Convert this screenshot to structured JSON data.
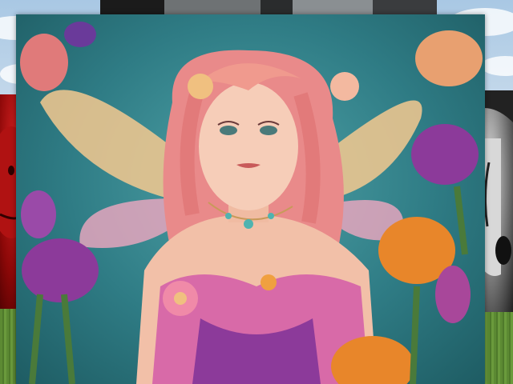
{
  "scene": {
    "description_label": "",
    "colors": {
      "teal_background": "#2f7c85",
      "hair": "#e98a8a",
      "tulip_purple": "#8c3a9a",
      "tulip_orange": "#e8862a",
      "tulip_pink": "#e07a7a",
      "dress": "#d86aa8",
      "grass": "#5c8a33",
      "sky": "#a9c8e4"
    }
  }
}
